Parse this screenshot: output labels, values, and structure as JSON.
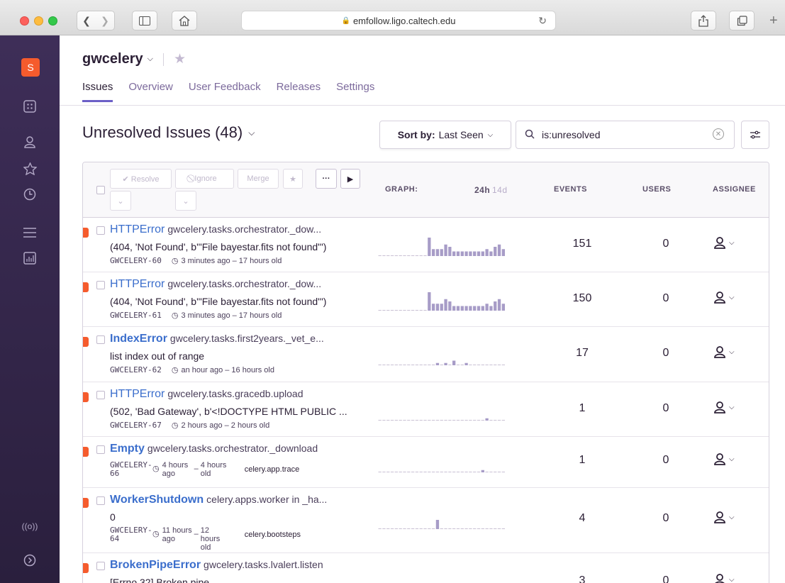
{
  "browser": {
    "url": "emfollow.ligo.caltech.edu"
  },
  "sidebar": {
    "org_initial": "S",
    "icons": [
      "projects-icon",
      "user-icon",
      "star-icon",
      "clock-icon",
      "menu-icon",
      "stats-icon",
      "broadcast-icon",
      "collapse-icon"
    ]
  },
  "project": {
    "name": "gwcelery",
    "tabs": [
      "Issues",
      "Overview",
      "User Feedback",
      "Releases",
      "Settings"
    ],
    "active_tab": "Issues"
  },
  "issues_header": {
    "title": "Unresolved Issues (48)",
    "sort_label": "Sort by:",
    "sort_value": "Last Seen",
    "search_value": "is:unresolved"
  },
  "table_header": {
    "resolve": "✔ Resolve",
    "ignore": "⃠ Ignore",
    "merge": "Merge",
    "more": "···",
    "graph": "GRAPH:",
    "range_24h": "24h",
    "range_14d": "14d",
    "events": "EVENTS",
    "users": "USERS",
    "assignee": "ASSIGNEE"
  },
  "issues": [
    {
      "type": "HTTPError",
      "culprit": "gwcelery.tasks.orchestrator._dow...",
      "message": "(404, 'Not Found', b'\"File bayestar.fits not found\"')",
      "short_id": "GWCELERY-60",
      "age": "3 minutes ago – 17 hours old",
      "events": "151",
      "users": "0",
      "spark": [
        0,
        0,
        0,
        0,
        0,
        0,
        0,
        0,
        0,
        0,
        0,
        0,
        8,
        3,
        3,
        3,
        5,
        4,
        2,
        2,
        2,
        2,
        2,
        2,
        2,
        2,
        3,
        2,
        4,
        5,
        3
      ]
    },
    {
      "type": "HTTPError",
      "culprit": "gwcelery.tasks.orchestrator._dow...",
      "message": "(404, 'Not Found', b'\"File bayestar.fits not found\"')",
      "short_id": "GWCELERY-61",
      "age": "3 minutes ago – 17 hours old",
      "events": "150",
      "users": "0",
      "spark": [
        0,
        0,
        0,
        0,
        0,
        0,
        0,
        0,
        0,
        0,
        0,
        0,
        8,
        3,
        3,
        3,
        5,
        4,
        2,
        2,
        2,
        2,
        2,
        2,
        2,
        2,
        3,
        2,
        4,
        5,
        3
      ]
    },
    {
      "type": "IndexError",
      "culprit": "gwcelery.tasks.first2years._vet_e...",
      "message": "list index out of range",
      "short_id": "GWCELERY-62",
      "age": "an hour ago – 16 hours old",
      "events": "17",
      "users": "0",
      "bold": true,
      "spark": [
        0,
        0,
        0,
        0,
        0,
        0,
        0,
        0,
        0,
        0,
        0,
        0,
        0,
        0,
        1,
        0,
        1,
        0,
        2,
        0,
        0,
        1,
        0,
        0,
        0,
        0,
        0,
        0,
        0,
        0,
        0
      ]
    },
    {
      "type": "HTTPError",
      "culprit": "gwcelery.tasks.gracedb.upload",
      "message": "(502, 'Bad Gateway', b'<!DOCTYPE HTML PUBLIC ...",
      "short_id": "GWCELERY-67",
      "age": "2 hours ago – 2 hours old",
      "events": "1",
      "users": "0",
      "spark": [
        0,
        0,
        0,
        0,
        0,
        0,
        0,
        0,
        0,
        0,
        0,
        0,
        0,
        0,
        0,
        0,
        0,
        0,
        0,
        0,
        0,
        0,
        0,
        0,
        0,
        0,
        1,
        0,
        0,
        0,
        0
      ]
    },
    {
      "type": "Empty",
      "culprit": "gwcelery.tasks.orchestrator._download",
      "message": "",
      "short_id_a": "GWCELERY-",
      "short_id_b": "66",
      "ago_a": "4 hours",
      "ago_b": "ago",
      "old_a": "4 hours",
      "old_b": "old",
      "logger": "celery.app.trace",
      "events": "1",
      "users": "0",
      "bold": true,
      "spark": [
        0,
        0,
        0,
        0,
        0,
        0,
        0,
        0,
        0,
        0,
        0,
        0,
        0,
        0,
        0,
        0,
        0,
        0,
        0,
        0,
        0,
        0,
        0,
        0,
        0,
        1,
        0,
        0,
        0,
        0,
        0
      ]
    },
    {
      "type": "WorkerShutdown",
      "culprit": "celery.apps.worker in _ha...",
      "message": "0",
      "short_id_a": "GWCELERY-",
      "short_id_b": "64",
      "ago_a": "11 hours",
      "ago_b": "ago",
      "old_a": "12 hours",
      "old_b": "old",
      "logger": "celery.bootsteps",
      "events": "4",
      "users": "0",
      "bold": true,
      "spark": [
        0,
        0,
        0,
        0,
        0,
        0,
        0,
        0,
        0,
        0,
        0,
        0,
        0,
        0,
        4,
        0,
        0,
        0,
        0,
        0,
        0,
        0,
        0,
        0,
        0,
        0,
        0,
        0,
        0,
        0,
        0
      ]
    },
    {
      "type": "BrokenPipeError",
      "culprit": "gwcelery.tasks.lvalert.listen",
      "message": "[Errno 32] Broken pipe",
      "events": "3",
      "users": "0",
      "bold": true,
      "spark": []
    }
  ],
  "colors": {
    "sidebar": "#3e2e58",
    "accent": "#6c5fc7",
    "link": "#3b6ecc",
    "level_error": "#f55b2d",
    "spark": "#a79cc7"
  }
}
